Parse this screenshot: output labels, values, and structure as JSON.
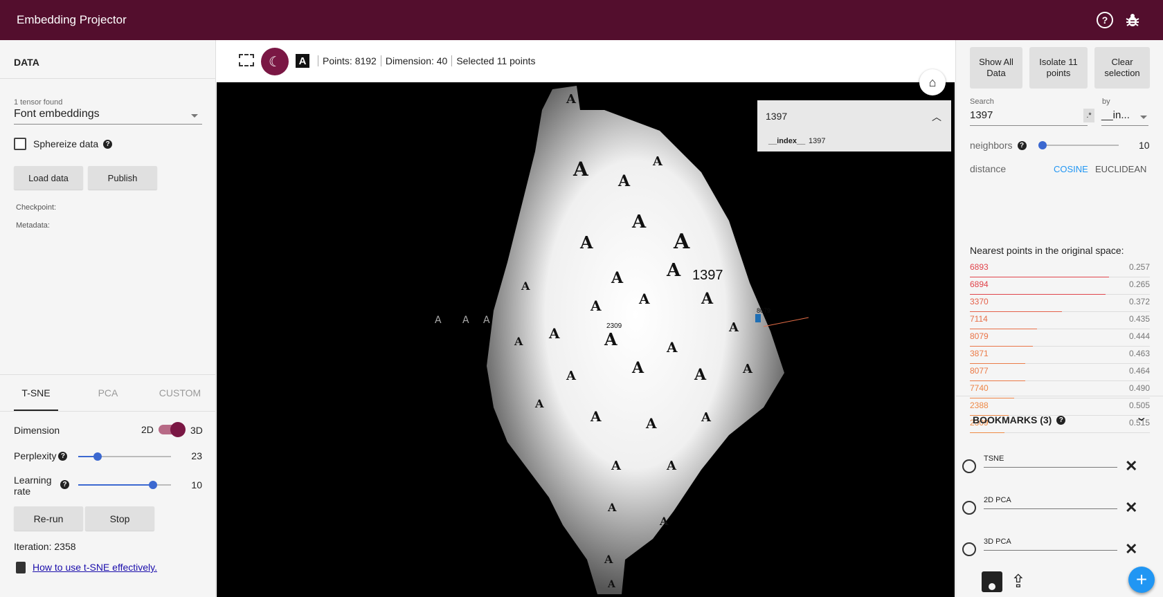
{
  "header": {
    "title": "Embedding Projector",
    "help_icon": "help-icon",
    "bug_icon": "bug-icon"
  },
  "data_panel": {
    "section_title": "DATA",
    "tensor_caption": "1 tensor found",
    "tensor_selected": "Font embeddings",
    "sphereize_label": "Sphereize data",
    "load_label": "Load data",
    "publish_label": "Publish",
    "checkpoint_label": "Checkpoint:",
    "metadata_label": "Metadata:"
  },
  "projection_tabs": [
    "T-SNE",
    "PCA",
    "CUSTOM"
  ],
  "tsne": {
    "dimension_label": "Dimension",
    "dim_2d": "2D",
    "dim_3d": "3D",
    "perplexity_label": "Perplexity",
    "perplexity_value": "23",
    "learning_rate_label_1": "Learning",
    "learning_rate_label_2": "rate",
    "learning_rate_value": "10",
    "rerun_label": "Re-run",
    "stop_label": "Stop",
    "iteration_text": "Iteration: 2358",
    "help_link": "How to use t-SNE effectively."
  },
  "toolbar": {
    "points": "Points: 8192",
    "dimension": "Dimension: 40",
    "selected": "Selected 11 points",
    "label_glyph": "A"
  },
  "canvas_labels": {
    "selected_point": "1397",
    "neighbor_a": "8079",
    "neighbor_b": "2309"
  },
  "popup": {
    "title": "1397",
    "key": "__index__",
    "value": "1397"
  },
  "inspector": {
    "show_all": "Show All Data",
    "isolate": "Isolate 11 points",
    "clear": "Clear selection",
    "search_caption": "Search",
    "search_value": "1397",
    "regex": ".*",
    "by_caption": "by",
    "by_value": "__in...",
    "neighbors_label": "neighbors",
    "neighbors_value": "10",
    "distance_label": "distance",
    "cosine": "COSINE",
    "euclidean": "EUCLIDEAN",
    "nearest_title": "Nearest points in the original space:"
  },
  "nearest": [
    {
      "id": "6893",
      "value": "0.257",
      "color": "#e0434a"
    },
    {
      "id": "6894",
      "value": "0.265",
      "color": "#e0434a"
    },
    {
      "id": "3370",
      "value": "0.372",
      "color": "#e5604a"
    },
    {
      "id": "7114",
      "value": "0.435",
      "color": "#e86f48"
    },
    {
      "id": "8079",
      "value": "0.444",
      "color": "#e97447"
    },
    {
      "id": "3871",
      "value": "0.463",
      "color": "#eb7a46"
    },
    {
      "id": "8077",
      "value": "0.464",
      "color": "#eb7a46"
    },
    {
      "id": "7740",
      "value": "0.490",
      "color": "#ed8345"
    },
    {
      "id": "2388",
      "value": "0.505",
      "color": "#ee8845"
    },
    {
      "id": "2309",
      "value": "0.515",
      "color": "#ef8b44"
    }
  ],
  "bookmarks": {
    "title": "BOOKMARKS (3)",
    "items": [
      "TSNE",
      "2D PCA",
      "3D PCA"
    ]
  },
  "colors": {
    "header": "#530e2d",
    "accent": "#7a1744",
    "link_blue": "#2196f3"
  }
}
